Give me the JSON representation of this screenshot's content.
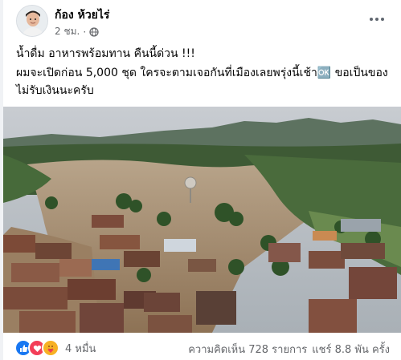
{
  "post": {
    "author": "ก้อง ห้วยไร่",
    "time": "2 ชม.",
    "privacy_icon": "globe-icon",
    "line1": "น้ำดื่ม อาหารพร้อมทาน คืนนี้ด่วน !!!",
    "line2": "ผมจะเปิดก่อน 5,000 ชุด ใครจะตามเจอกันที่เมืองเลยพรุ่งนี้เช้า🆗 ขอเป็นของ",
    "line3": "ไม่รับเงินนะครับ",
    "image_alt": "flooded town aerial photo"
  },
  "engagement": {
    "reaction_icons": [
      "like-icon",
      "love-icon",
      "care-icon"
    ],
    "reaction_count": "4 หมื่น",
    "comments": "ความคิดเห็น 728 รายการ",
    "shares": "แชร์ 8.8 พัน ครั้ง"
  },
  "colors": {
    "like": "#1877f2",
    "love": "#f33e58",
    "care": "#f7b125",
    "meta_text": "#65676b",
    "flood_water": "#a08a70"
  }
}
